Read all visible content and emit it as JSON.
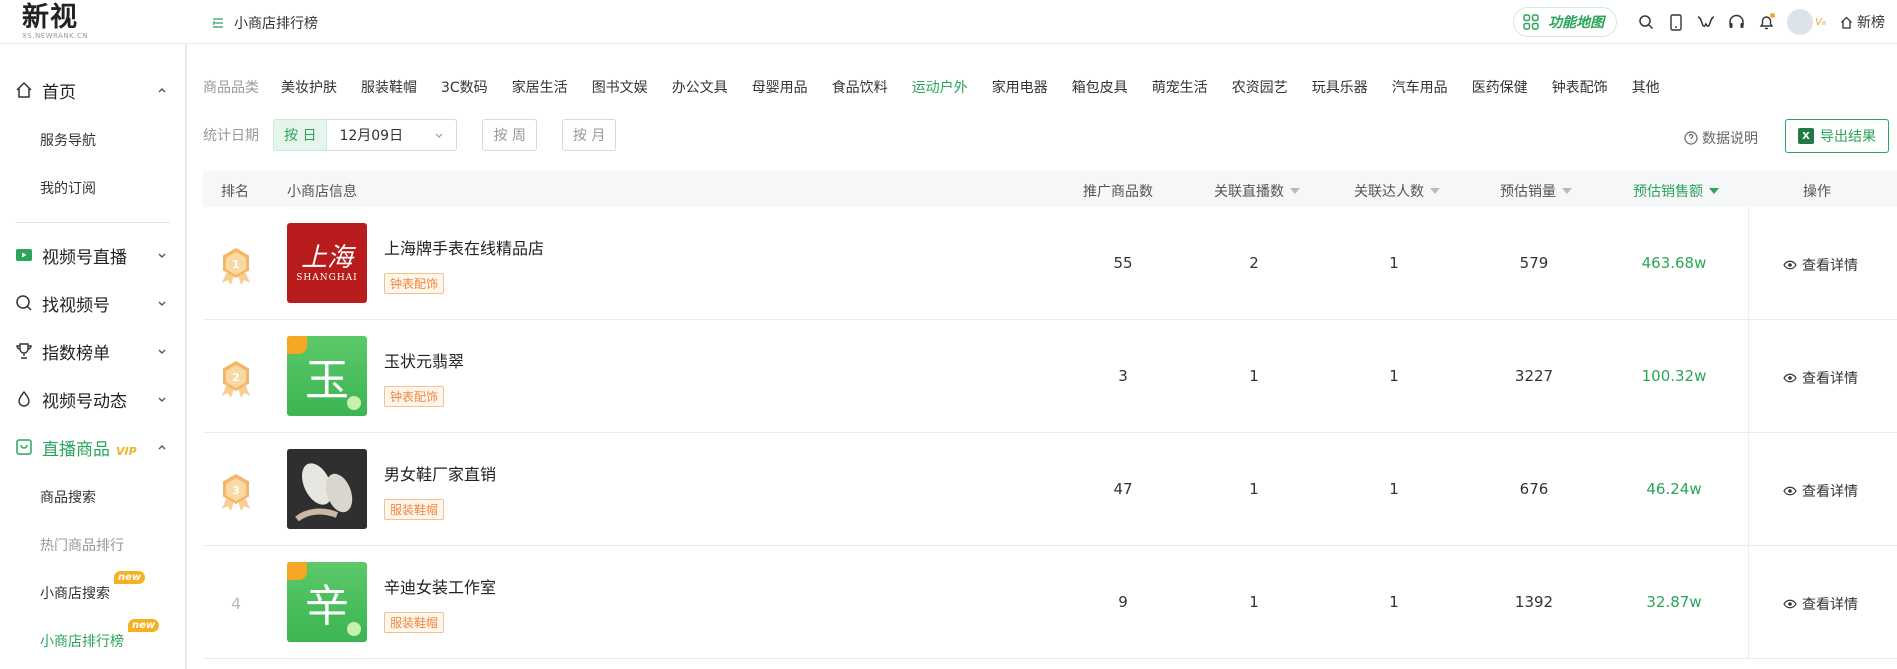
{
  "brand": {
    "name": "新视",
    "sub": "XS.NEWRANK.CN"
  },
  "header": {
    "page_title": "小商店排行榜",
    "feature_map": "功能地图",
    "user_badge": "V₆",
    "home_link": "新榜"
  },
  "sidebar": {
    "items": [
      {
        "label": "首页"
      },
      {
        "label": "视频号直播"
      },
      {
        "label": "找视频号"
      },
      {
        "label": "指数榜单"
      },
      {
        "label": "视频号动态"
      },
      {
        "label": "直播商品",
        "badge": "VIP"
      }
    ],
    "sub_home": [
      "服务导航",
      "我的订阅"
    ],
    "sub_goods": [
      {
        "label": "商品搜索"
      },
      {
        "label": "热门商品排行"
      },
      {
        "label": "小商店搜索",
        "tag": "new"
      },
      {
        "label": "小商店排行榜",
        "tag": "new"
      }
    ]
  },
  "filters": {
    "category_label": "商品品类",
    "categories": [
      "美妆护肤",
      "服装鞋帽",
      "3C数码",
      "家居生活",
      "图书文娱",
      "办公文具",
      "母婴用品",
      "食品饮料",
      "运动户外",
      "家用电器",
      "箱包皮具",
      "萌宠生活",
      "农资园艺",
      "玩具乐器",
      "汽车用品",
      "医药保健",
      "钟表配饰",
      "其他"
    ],
    "active_category": "运动户外",
    "date_label": "统计日期",
    "by_day": "按 日",
    "date_value": "12月09日",
    "by_week": "按 周",
    "by_month": "按 月",
    "data_explain": "数据说明",
    "export": "导出结果"
  },
  "table": {
    "headers": {
      "rank": "排名",
      "shop": "小商店信息",
      "products": "推广商品数",
      "lives": "关联直播数",
      "talents": "关联达人数",
      "est_volume": "预估销量",
      "est_sales": "预估销售额",
      "action": "操作"
    },
    "rows": [
      {
        "rank": "1",
        "name": "上海牌手表在线精品店",
        "tag": "钟表配饰",
        "thumb_text": "上海",
        "thumb_sub": "SHANGHAI",
        "products": "55",
        "lives": "2",
        "talents": "1",
        "volume": "579",
        "sales": "463.68w",
        "action": "查看详情"
      },
      {
        "rank": "2",
        "name": "玉状元翡翠",
        "tag": "钟表配饰",
        "thumb_text": "玉",
        "products": "3",
        "lives": "1",
        "talents": "1",
        "volume": "3227",
        "sales": "100.32w",
        "action": "查看详情"
      },
      {
        "rank": "3",
        "name": "男女鞋厂家直销",
        "tag": "服装鞋帽",
        "products": "47",
        "lives": "1",
        "talents": "1",
        "volume": "676",
        "sales": "46.24w",
        "action": "查看详情"
      },
      {
        "rank": "4",
        "name": "辛迪女装工作室",
        "tag": "服装鞋帽",
        "thumb_text": "辛",
        "products": "9",
        "lives": "1",
        "talents": "1",
        "volume": "1392",
        "sales": "32.87w",
        "action": "查看详情"
      }
    ]
  },
  "colors": {
    "accent": "#2aa55a",
    "medal": "#f5b766",
    "tag": "#f0883b"
  }
}
